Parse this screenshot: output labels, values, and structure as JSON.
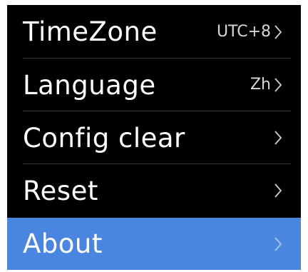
{
  "settings_menu": {
    "items": [
      {
        "label": "TimeZone",
        "value": "UTC+8",
        "icon": "chevron-right-icon",
        "selected": false
      },
      {
        "label": "Language",
        "value": "Zh",
        "icon": "chevron-right-icon",
        "selected": false
      },
      {
        "label": "Config clear",
        "value": "",
        "icon": "chevron-right-icon",
        "selected": false
      },
      {
        "label": "Reset",
        "value": "",
        "icon": "chevron-right-icon",
        "selected": false
      },
      {
        "label": "About",
        "value": "",
        "icon": "chevron-right-icon",
        "selected": true
      }
    ]
  },
  "colors": {
    "background": "#000000",
    "selected_background": "#4a86df",
    "text": "#ffffff",
    "divider": "#3a3a3a"
  }
}
